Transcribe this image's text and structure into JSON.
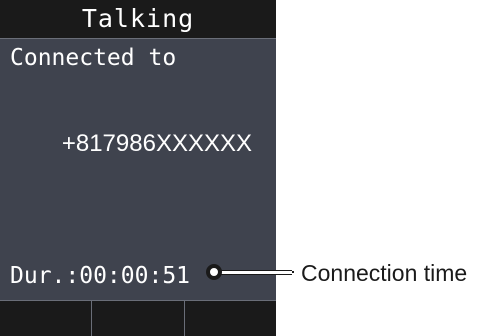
{
  "screen": {
    "title": "Talking",
    "connected_label": "Connected to",
    "phone_number": "+817986XXXXXX",
    "duration": "Dur.:00:00:51",
    "softkeys": [
      "",
      "",
      ""
    ]
  },
  "annotation": {
    "label": "Connection time"
  },
  "colors": {
    "title_bar_bg": "#1a1a1a",
    "content_bg": "#3f434e",
    "text": "#ffffff",
    "callout_text": "#1a1a1a"
  }
}
